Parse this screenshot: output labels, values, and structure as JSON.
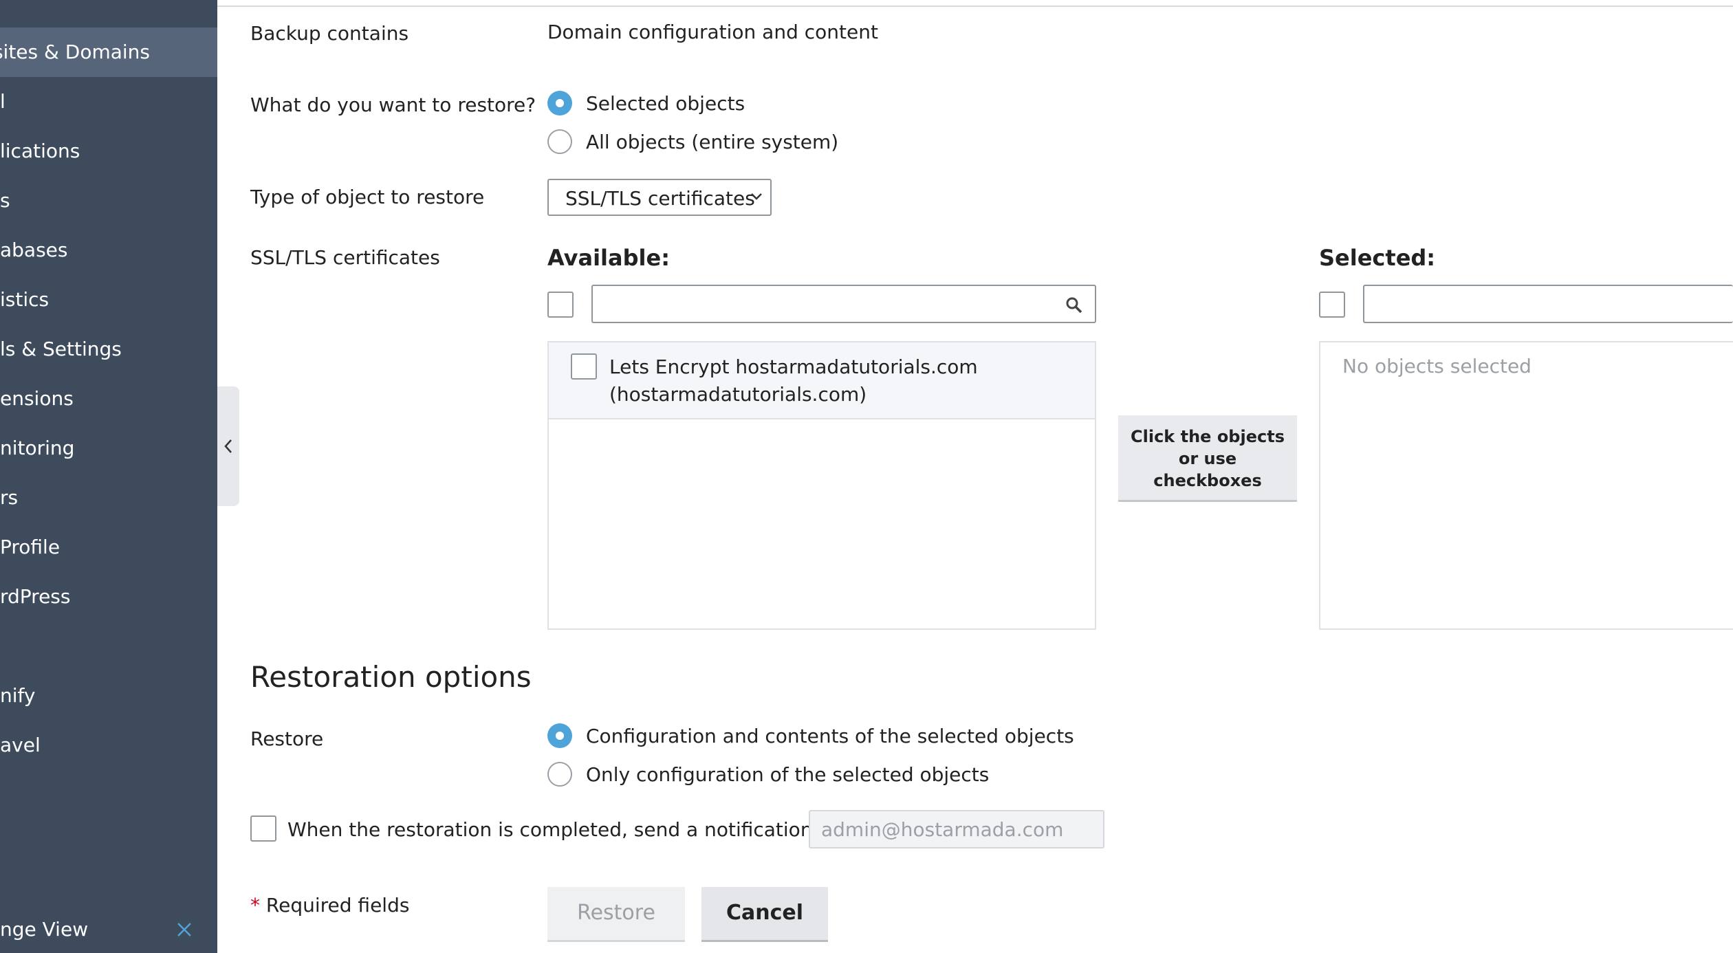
{
  "sidebar": {
    "items": [
      {
        "label": "osites & Domains",
        "active": true
      },
      {
        "label": "l"
      },
      {
        "label": "lications"
      },
      {
        "label": "s"
      },
      {
        "label": "abases"
      },
      {
        "label": "istics"
      },
      {
        "label": "ls & Settings"
      },
      {
        "label": "ensions"
      },
      {
        "label": "nitoring"
      },
      {
        "label": "rs"
      },
      {
        "label": "Profile"
      },
      {
        "label": "rdPress"
      },
      {
        "label": "nify"
      },
      {
        "label": "avel"
      }
    ],
    "bottom_label": "nge View"
  },
  "form": {
    "backup_contains_label": "Backup contains",
    "backup_contains_value": "Domain configuration and content",
    "restore_what_label": "What do you want to restore?",
    "restore_what_options": [
      "Selected objects",
      "All objects (entire system)"
    ],
    "restore_what_selected": 0,
    "object_type_label": "Type of object to restore",
    "object_type_value": "SSL/TLS certificates",
    "certs_label": "SSL/TLS certificates"
  },
  "available": {
    "heading": "Available:",
    "items": [
      {
        "line1": "Lets Encrypt hostarmadatutorials.com",
        "line2": "(hostarmadatutorials.com)"
      }
    ]
  },
  "hint_button": {
    "line1": "Click the objects",
    "line2": "or use",
    "line3": "checkboxes"
  },
  "selected": {
    "heading": "Selected:",
    "empty_text": "No objects selected"
  },
  "restoration": {
    "title": "Restoration options",
    "restore_label": "Restore",
    "options": [
      "Configuration and contents of the selected objects",
      "Only configuration of the selected objects"
    ],
    "selected": 0,
    "notify_label": "When the restoration is completed, send a notification to",
    "notify_placeholder": "admin@hostarmada.com"
  },
  "footer": {
    "required_star": "*",
    "required_text": "Required fields",
    "restore_button": "Restore",
    "cancel_button": "Cancel"
  },
  "colors": {
    "sidebar_bg": "#3d4b5c",
    "sidebar_active": "#56657a",
    "radio_accent": "#4ea3d8",
    "required_star": "#d0021b"
  }
}
